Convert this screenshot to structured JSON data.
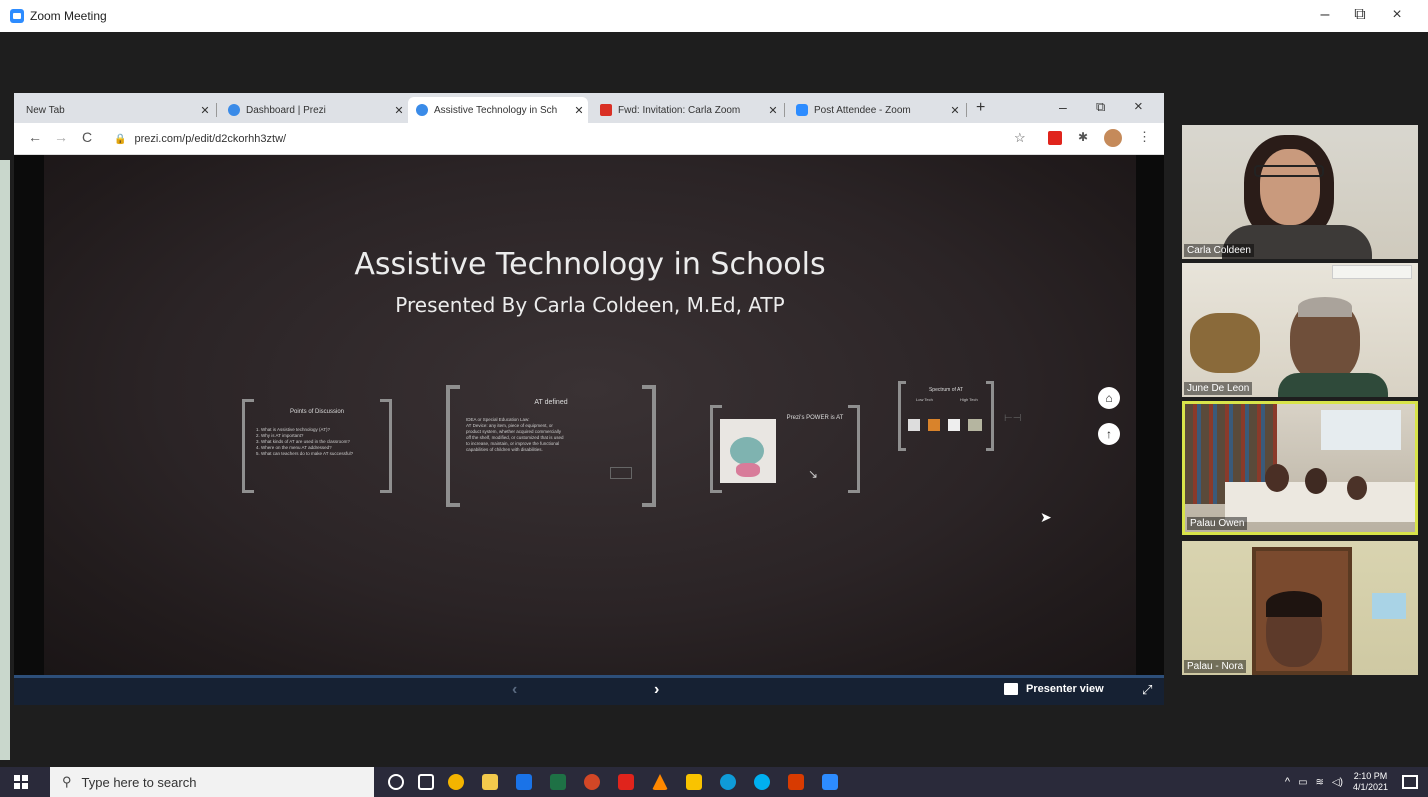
{
  "zoom": {
    "window_title": "Zoom Meeting",
    "min_glyph": "–",
    "max_glyph": "⧉",
    "close_glyph": "×"
  },
  "browser": {
    "tabs": [
      {
        "label": "New Tab",
        "active": false
      },
      {
        "label": "Dashboard | Prezi",
        "active": false
      },
      {
        "label": "Assistive Technology in Sch",
        "active": true
      },
      {
        "label": "Fwd: Invitation: Carla Zoom",
        "active": false
      },
      {
        "label": "Post Attendee - Zoom",
        "active": false
      }
    ],
    "tab_close_glyph": "✕",
    "new_tab_glyph": "+",
    "url": "prezi.com/p/edit/d2ckorhh3ztw/",
    "back_glyph": "←",
    "forward_glyph": "→",
    "reload_glyph": "C"
  },
  "slide": {
    "title": "Assistive Technology in Schools",
    "subtitle": "Presented By Carla Coldeen, M.Ed, ATP",
    "frames": [
      {
        "title": "Points of Discussion",
        "lines": [
          "1. What is Assistive technology (AT)?",
          "2. Why is AT important?",
          "3. What kinds of AT are used in the classroom?",
          "4. Where on the menu AT addressed?",
          "5. What can teachers do to make AT successful?"
        ]
      },
      {
        "title": "AT defined",
        "lines": [
          "IDEA or Special Education Law:",
          "AT Device: any item, piece of equipment, or",
          "product system, whether acquired commercially",
          "off the shelf, modified, or customized that is used",
          "to increase, maintain, or improve the functional",
          "capabilities of children with disabilities."
        ]
      },
      {
        "title": "Prezi's POWER is AT",
        "lines": []
      },
      {
        "title": "Spectrum of AT",
        "lines": [
          "Low Tech",
          "High Tech"
        ]
      }
    ]
  },
  "prezi_bar": {
    "prev_glyph": "‹",
    "next_glyph": "›",
    "presenter_view": "Presenter view",
    "home_glyph": "⌂",
    "up_glyph": "↑"
  },
  "participants": [
    {
      "name": "Carla Coldeen",
      "active": false
    },
    {
      "name": "June De Leon",
      "active": false
    },
    {
      "name": "Palau Owen",
      "active": true
    },
    {
      "name": "Palau - Nora",
      "active": false
    }
  ],
  "taskbar": {
    "search_placeholder": "Type here to search",
    "time": "2:10 PM",
    "date": "4/1/2021"
  }
}
